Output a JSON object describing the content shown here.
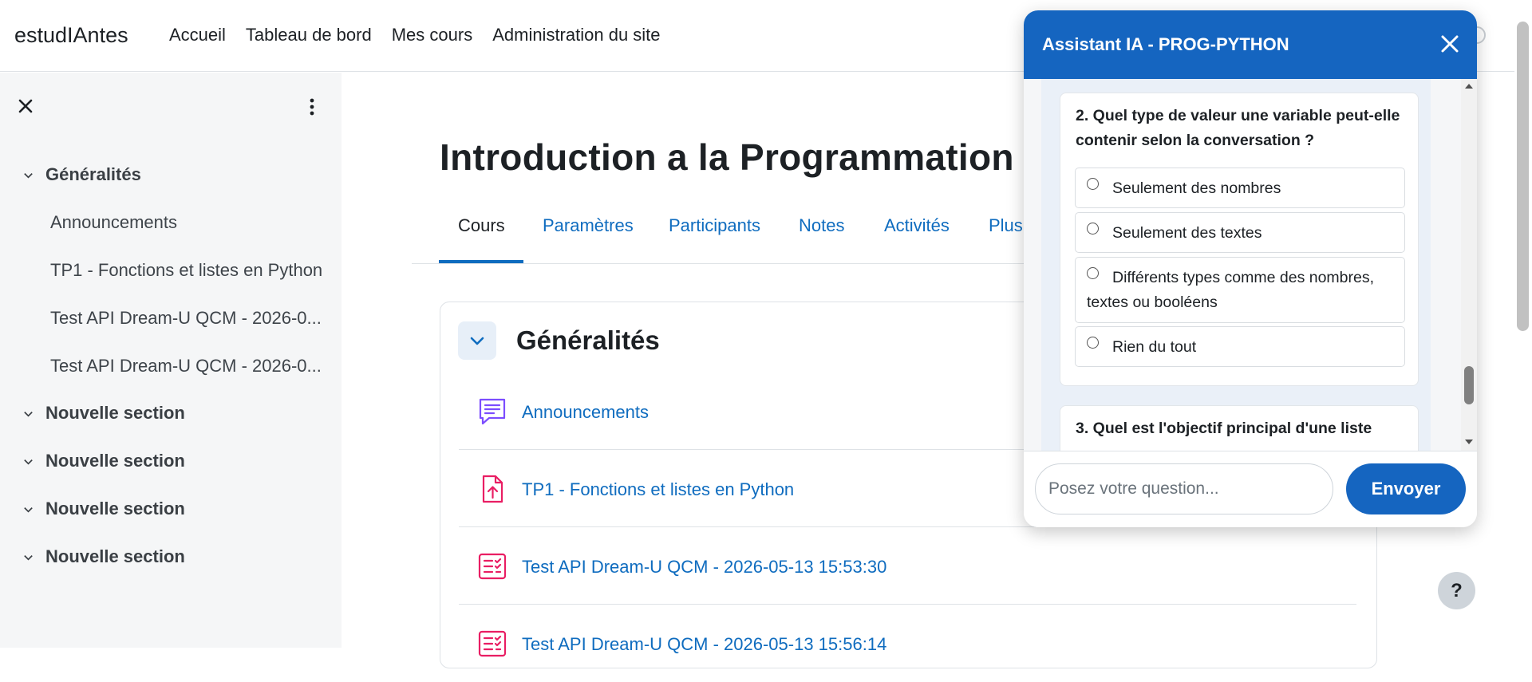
{
  "navbar": {
    "brand": "estudIAntes",
    "links": [
      "Accueil",
      "Tableau de bord",
      "Mes cours",
      "Administration du site"
    ]
  },
  "drawer": {
    "items": [
      {
        "type": "section",
        "label": "Généralités"
      },
      {
        "type": "activity",
        "label": "Announcements"
      },
      {
        "type": "activity",
        "label": "TP1 - Fonctions et listes en Python"
      },
      {
        "type": "activity",
        "label": "Test API Dream-U QCM - 2026-0..."
      },
      {
        "type": "activity",
        "label": "Test API Dream-U QCM - 2026-0..."
      },
      {
        "type": "section",
        "label": "Nouvelle section"
      },
      {
        "type": "section",
        "label": "Nouvelle section"
      },
      {
        "type": "section",
        "label": "Nouvelle section"
      },
      {
        "type": "section",
        "label": "Nouvelle section"
      }
    ]
  },
  "course": {
    "title": "Introduction a la Programmation P",
    "tabs": [
      "Cours",
      "Paramètres",
      "Participants",
      "Notes",
      "Activités",
      "Plus"
    ],
    "active_tab": "Cours",
    "section_title": "Généralités",
    "activities": [
      {
        "icon": "forum-icon",
        "label": "Announcements"
      },
      {
        "icon": "assignment-icon",
        "label": "TP1 - Fonctions et listes en Python"
      },
      {
        "icon": "quiz-icon",
        "label": "Test API Dream-U QCM - 2026-05-13 15:53:30"
      },
      {
        "icon": "quiz-icon",
        "label": "Test API Dream-U QCM - 2026-05-13 15:56:14"
      }
    ]
  },
  "assistant": {
    "title": "Assistant IA - PROG-PYTHON",
    "question2": {
      "text": "2. Quel type de valeur une variable peut-elle contenir selon la conversation ?",
      "options": [
        "Seulement des nombres",
        "Seulement des textes",
        "Différents types comme des nombres, textes ou booléens",
        "Rien du tout"
      ]
    },
    "question3_text": "3. Quel est l'objectif principal d'une liste",
    "input_placeholder": "Posez votre question...",
    "send_label": "Envoyer"
  },
  "help_label": "?",
  "colors": {
    "primary": "#0f6cbf",
    "assistant_header": "#1565c0",
    "drawer_bg": "#f5f6f7",
    "assignment_icon": "#e91e63",
    "forum_icon": "#7c4dff"
  }
}
